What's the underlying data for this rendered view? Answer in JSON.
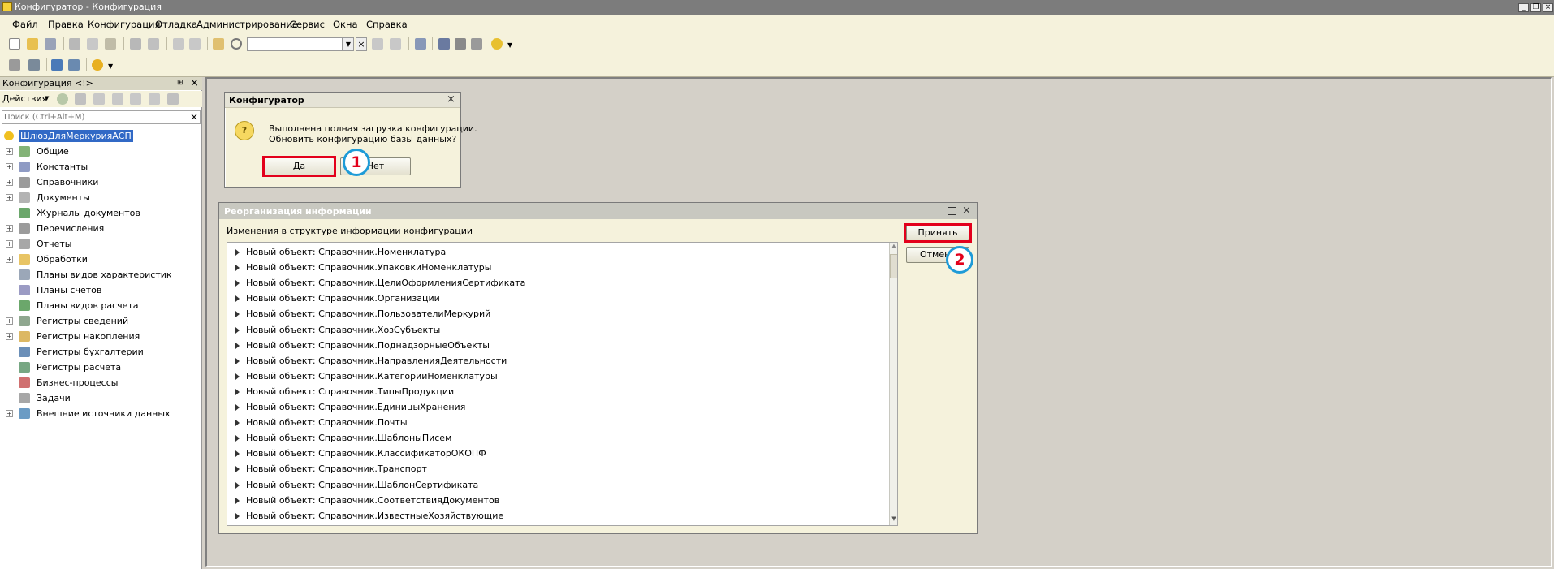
{
  "window": {
    "title": "Конфигуратор - Конфигурация"
  },
  "menu": [
    "Файл",
    "Правка",
    "Конфигурация",
    "Отладка",
    "Администрирование",
    "Сервис",
    "Окна",
    "Справка"
  ],
  "left_panel": {
    "title": "Конфигурация <!>",
    "actions_label": "Действия",
    "search_placeholder": "Поиск (Ctrl+Alt+M)",
    "root": "ШлюзДляМеркурияАСП",
    "items": [
      {
        "label": "Общие",
        "expand": true,
        "icon": "common-icon"
      },
      {
        "label": "Константы",
        "expand": true,
        "icon": "constants-icon"
      },
      {
        "label": "Справочники",
        "expand": true,
        "icon": "catalogs-icon"
      },
      {
        "label": "Документы",
        "expand": true,
        "icon": "documents-icon"
      },
      {
        "label": "Журналы документов",
        "expand": false,
        "icon": "journals-icon"
      },
      {
        "label": "Перечисления",
        "expand": true,
        "icon": "enums-icon"
      },
      {
        "label": "Отчеты",
        "expand": true,
        "icon": "reports-icon"
      },
      {
        "label": "Обработки",
        "expand": true,
        "icon": "dataprocessors-icon"
      },
      {
        "label": "Планы видов характеристик",
        "expand": false,
        "icon": "chart-of-characteristics-icon"
      },
      {
        "label": "Планы счетов",
        "expand": false,
        "icon": "chart-of-accounts-icon"
      },
      {
        "label": "Планы видов расчета",
        "expand": false,
        "icon": "calc-types-icon"
      },
      {
        "label": "Регистры сведений",
        "expand": true,
        "icon": "info-registers-icon"
      },
      {
        "label": "Регистры накопления",
        "expand": true,
        "icon": "accum-registers-icon"
      },
      {
        "label": "Регистры бухгалтерии",
        "expand": false,
        "icon": "accounting-registers-icon"
      },
      {
        "label": "Регистры расчета",
        "expand": false,
        "icon": "calc-registers-icon"
      },
      {
        "label": "Бизнес-процессы",
        "expand": false,
        "icon": "business-process-icon"
      },
      {
        "label": "Задачи",
        "expand": false,
        "icon": "tasks-icon"
      },
      {
        "label": "Внешние источники данных",
        "expand": true,
        "icon": "external-sources-icon"
      }
    ]
  },
  "dialog_confirm": {
    "title": "Конфигуратор",
    "message_line1": "Выполнена полная загрузка конфигурации.",
    "message_line2": "Обновить конфигурацию базы данных?",
    "yes": "Да",
    "no": "Нет",
    "badge": "1"
  },
  "dialog_reorg": {
    "title": "Реорганизация информации",
    "subtitle": "Изменения в структуре информации конфигурации",
    "accept": "Принять",
    "cancel": "Отмена",
    "badge": "2",
    "changes": [
      "Новый объект: Справочник.Номенклатура",
      "Новый объект: Справочник.УпаковкиНоменклатуры",
      "Новый объект: Справочник.ЦелиОформленияСертификата",
      "Новый объект: Справочник.Организации",
      "Новый объект: Справочник.ПользователиМеркурий",
      "Новый объект: Справочник.ХозСубъекты",
      "Новый объект: Справочник.ПоднадзорныеОбъекты",
      "Новый объект: Справочник.НаправленияДеятельности",
      "Новый объект: Справочник.КатегорииНоменклатуры",
      "Новый объект: Справочник.ТипыПродукции",
      "Новый объект: Справочник.ЕдиницыХранения",
      "Новый объект: Справочник.Почты",
      "Новый объект: Справочник.ШаблоныПисем",
      "Новый объект: Справочник.КлассификаторОКОПФ",
      "Новый объект: Справочник.Транспорт",
      "Новый объект: Справочник.ШаблонСертификата",
      "Новый объект: Справочник.СоответствияДокументов",
      "Новый объект: Справочник.ИзвестныеХозяйствующие"
    ]
  },
  "colors": {
    "highlight": "#e3001b",
    "badge_ring": "#1e9bd7",
    "selection": "#3169c6"
  }
}
